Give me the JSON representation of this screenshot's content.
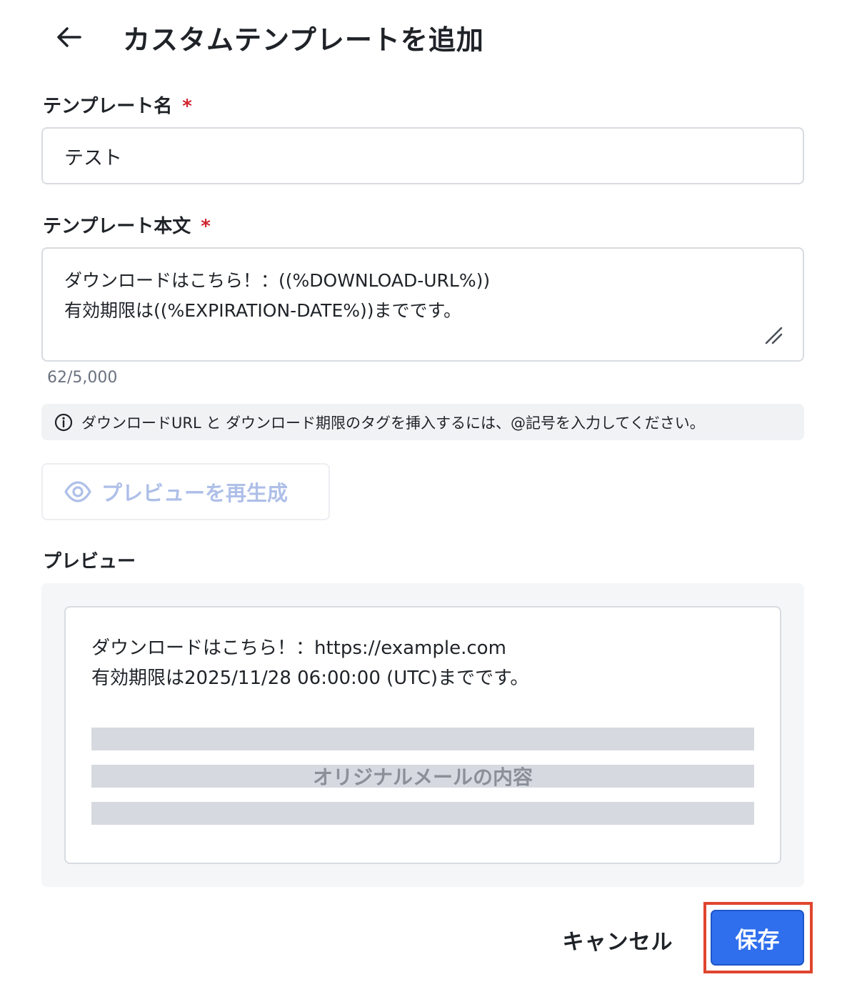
{
  "header": {
    "back_icon": "arrow-left-icon",
    "title": "カスタムテンプレートを追加"
  },
  "template_name": {
    "label": "テンプレート名",
    "required_mark": "*",
    "value": "テスト"
  },
  "template_body": {
    "label": "テンプレート本文",
    "required_mark": "*",
    "lines": [
      "ダウンロードはこちら！：((%DOWNLOAD-URL%))",
      "有効期限は((%EXPIRATION-DATE%))までです。"
    ],
    "counter": "62/5,000"
  },
  "hint": {
    "icon": "info-icon",
    "text": "ダウンロードURL と ダウンロード期限のタグを挿入するには、@記号を入力してください。"
  },
  "regenerate_button": {
    "icon": "eye-icon",
    "label": "プレビューを再生成"
  },
  "preview": {
    "label": "プレビュー",
    "lines": [
      "ダウンロードはこちら！：https://example.com",
      "有効期限は2025/11/28 06:00:00 (UTC)までです。"
    ],
    "original_mail_label": "オリジナルメールの内容"
  },
  "actions": {
    "cancel_label": "キャンセル",
    "save_label": "保存"
  },
  "colors": {
    "primary": "#2f6fed",
    "required": "#d1242f",
    "highlight": "#e0452f",
    "disabled_text": "#aebfe8"
  }
}
